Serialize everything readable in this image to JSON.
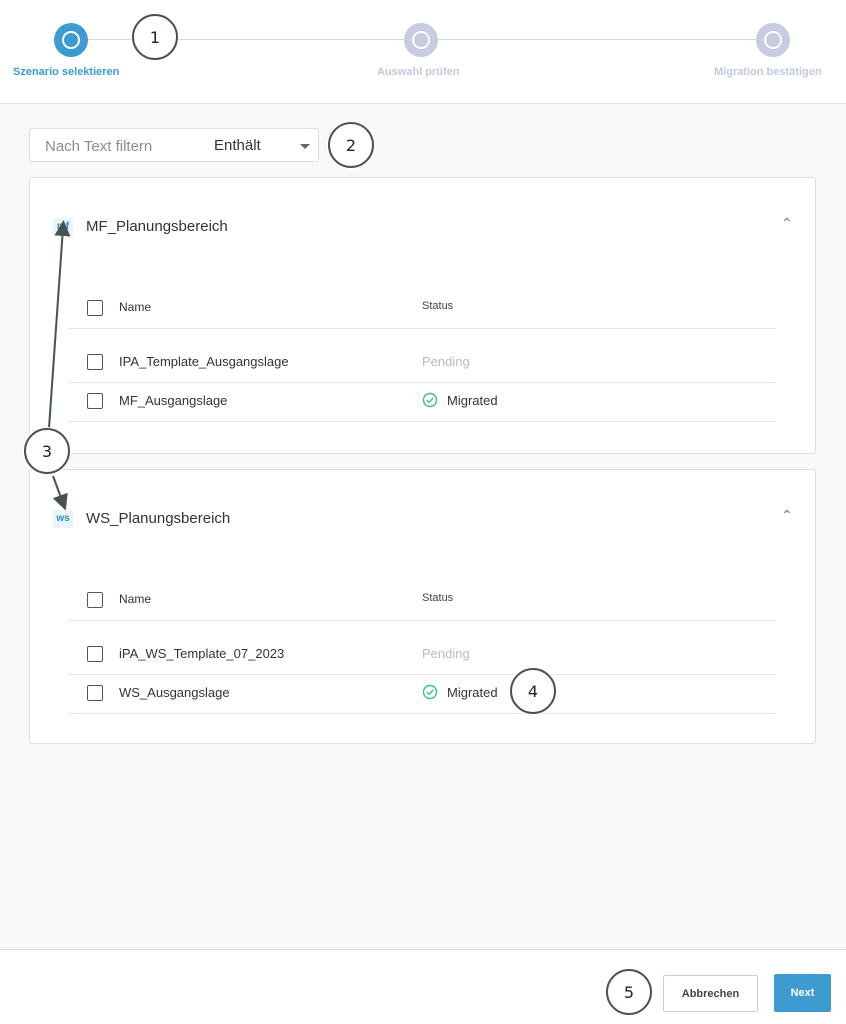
{
  "stepper": {
    "steps": [
      {
        "label": "Szenario selektieren",
        "state": "active"
      },
      {
        "label": "Auswahl prüfen",
        "state": "inactive"
      },
      {
        "label": "Migration bestätigen",
        "state": "inactive"
      }
    ]
  },
  "filter": {
    "placeholder": "Nach Text filtern",
    "mode": "Enthält"
  },
  "groups": [
    {
      "badge": "mf",
      "title": "MF_Planungsbereich",
      "columns": {
        "name": "Name",
        "status": "Status"
      },
      "rows": [
        {
          "name": "IPA_Template_Ausgangslage",
          "status": "Pending"
        },
        {
          "name": "MF_Ausgangslage",
          "status": "Migrated"
        }
      ]
    },
    {
      "badge": "ws",
      "title": "WS_Planungsbereich",
      "columns": {
        "name": "Name",
        "status": "Status"
      },
      "rows": [
        {
          "name": "iPA_WS_Template_07_2023",
          "status": "Pending"
        },
        {
          "name": "WS_Ausgangslage",
          "status": "Migrated"
        }
      ]
    }
  ],
  "callouts": [
    "1",
    "2",
    "3",
    "4",
    "5"
  ],
  "footer": {
    "cancel_label": "Abbrechen",
    "next_label": "Next"
  },
  "colors": {
    "accent": "#3d9bd2",
    "inactive_step": "#c9cbe0",
    "migrated_icon": "#3dbf86",
    "pending_text": "#b8bbc2"
  }
}
